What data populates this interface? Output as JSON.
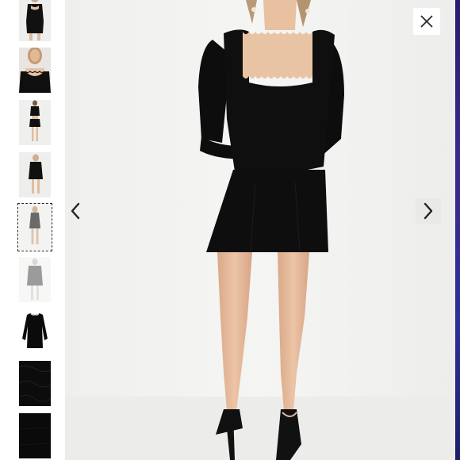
{
  "viewer": {
    "thumbnails": [
      {
        "name": "thumb-1",
        "selected": false
      },
      {
        "name": "thumb-2",
        "selected": false
      },
      {
        "name": "thumb-3",
        "selected": false
      },
      {
        "name": "thumb-4",
        "selected": false
      },
      {
        "name": "thumb-5",
        "selected": true
      },
      {
        "name": "thumb-6",
        "selected": false
      },
      {
        "name": "thumb-7",
        "selected": false
      },
      {
        "name": "thumb-8",
        "selected": false
      },
      {
        "name": "thumb-9",
        "selected": false
      }
    ],
    "icons": {
      "close": "close-icon",
      "prev": "chevron-left-icon",
      "next": "chevron-right-icon"
    },
    "colors": {
      "dress": "#0d0d0d",
      "skin": "#e7c3a4",
      "background": "#f2f2f0",
      "accent_edge": "#2d2a8a"
    }
  }
}
